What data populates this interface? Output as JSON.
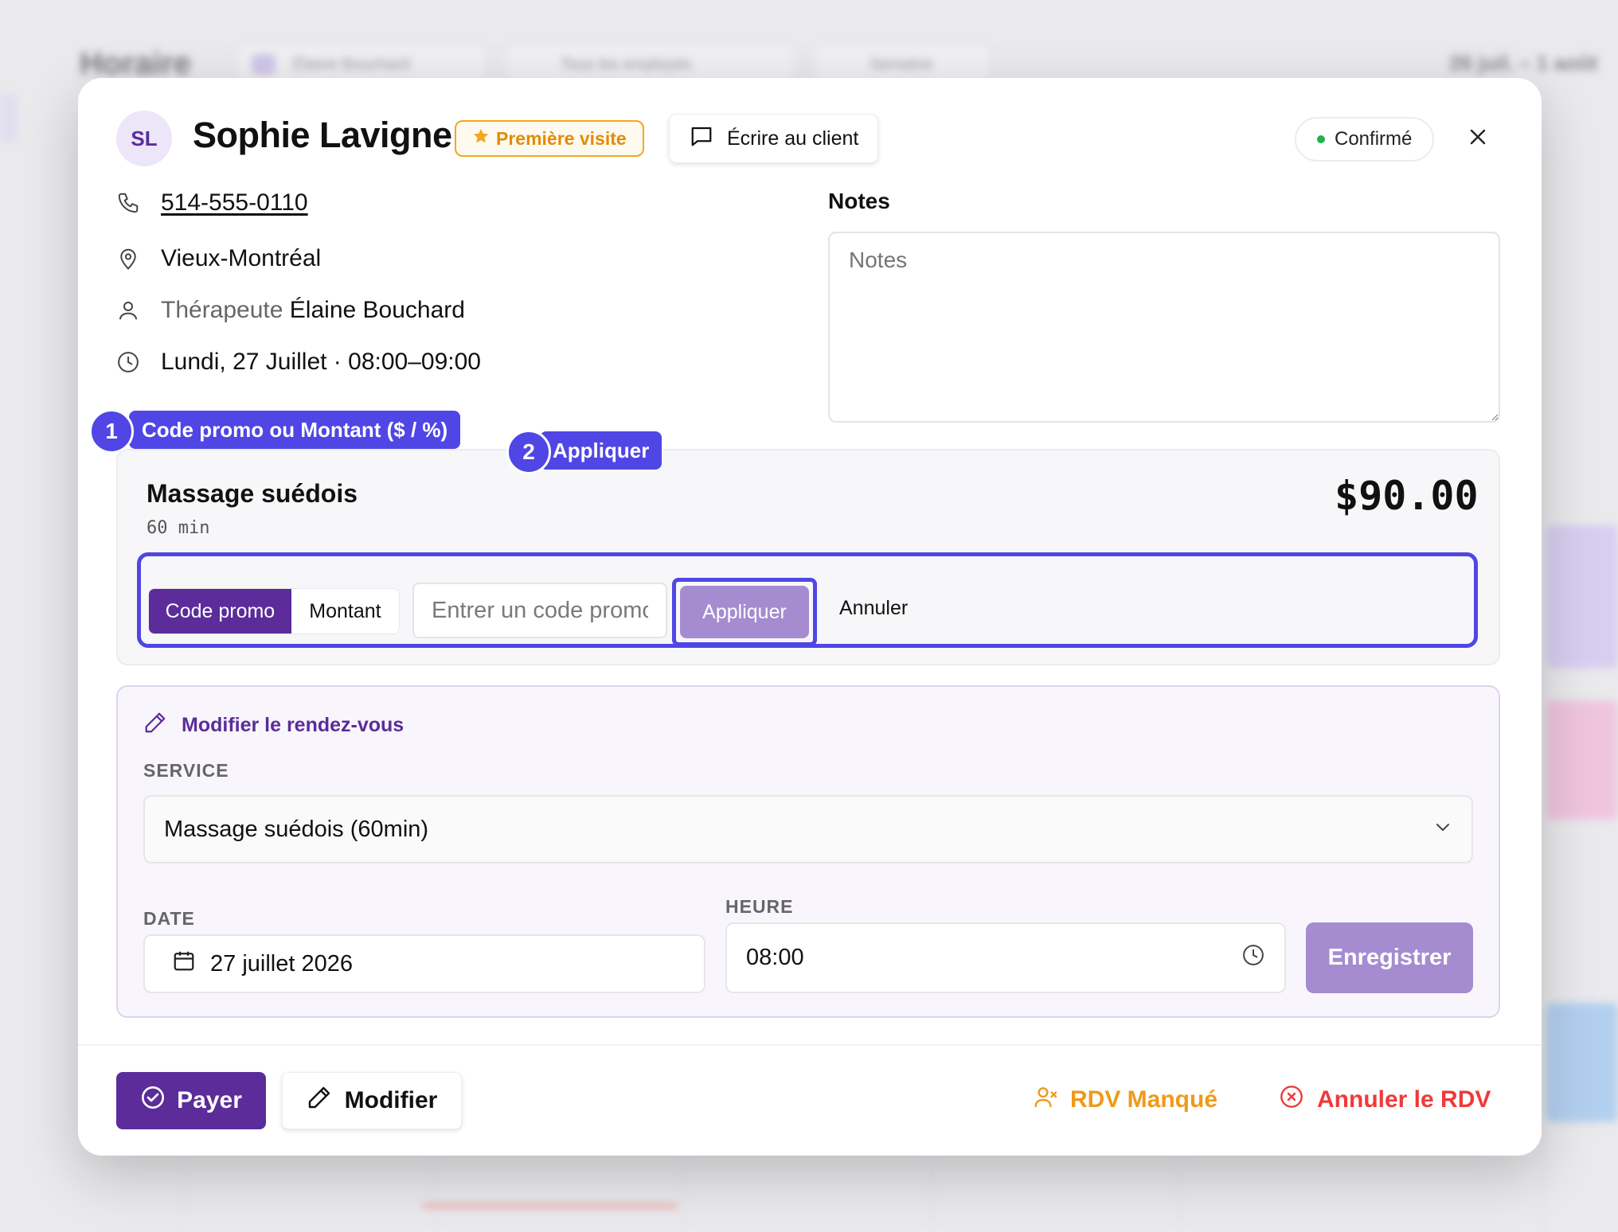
{
  "background": {
    "page_title": "Horaire",
    "chips": [
      "Élaine Bouchard",
      "Tous les employés",
      "Semaine"
    ],
    "date_range": "26 juil. – 1 août"
  },
  "client": {
    "initials": "SL",
    "name": "Sophie Lavigne",
    "first_visit_badge": "Première visite",
    "write_button": "Écrire au client",
    "status": "Confirmé",
    "phone": "514-555-0110",
    "location": "Vieux-Montréal",
    "therapist_prefix": "Thérapeute",
    "therapist_name": "Élaine Bouchard",
    "datetime": "Lundi, 27 Juillet · 08:00–09:00"
  },
  "notes": {
    "label": "Notes",
    "placeholder": "Notes",
    "value": ""
  },
  "service": {
    "title": "Massage suédois",
    "duration": "60 min",
    "price": "$90.00"
  },
  "promo": {
    "mode_options": [
      "Code promo",
      "Montant"
    ],
    "selected_mode": "Code promo",
    "input_placeholder": "Entrer un code promo",
    "apply_label": "Appliquer",
    "cancel_label": "Annuler",
    "annotations": [
      {
        "number": "1",
        "label": "Code promo ou Montant ($ / %)"
      },
      {
        "number": "2",
        "label": "Appliquer"
      }
    ]
  },
  "edit": {
    "heading": "Modifier le rendez-vous",
    "service_label": "SERVICE",
    "service_value": "Massage suédois (60min)",
    "date_label": "DATE",
    "date_value": "27 juillet 2026",
    "time_label": "HEURE",
    "time_value": "08:00",
    "save_label": "Enregistrer"
  },
  "footer": {
    "pay_label": "Payer",
    "modify_label": "Modifier",
    "missed_label": "RDV Manqué",
    "cancel_label": "Annuler le RDV"
  },
  "colors": {
    "brand_purple": "#5b2c9a",
    "annotation_blue": "#5046e5",
    "disabled_purple": "#a58cd0",
    "badge_orange": "#f2a81d",
    "missed_orange": "#ee9a1a",
    "cancel_red": "#ef3a3a",
    "status_green": "#22b14c"
  }
}
